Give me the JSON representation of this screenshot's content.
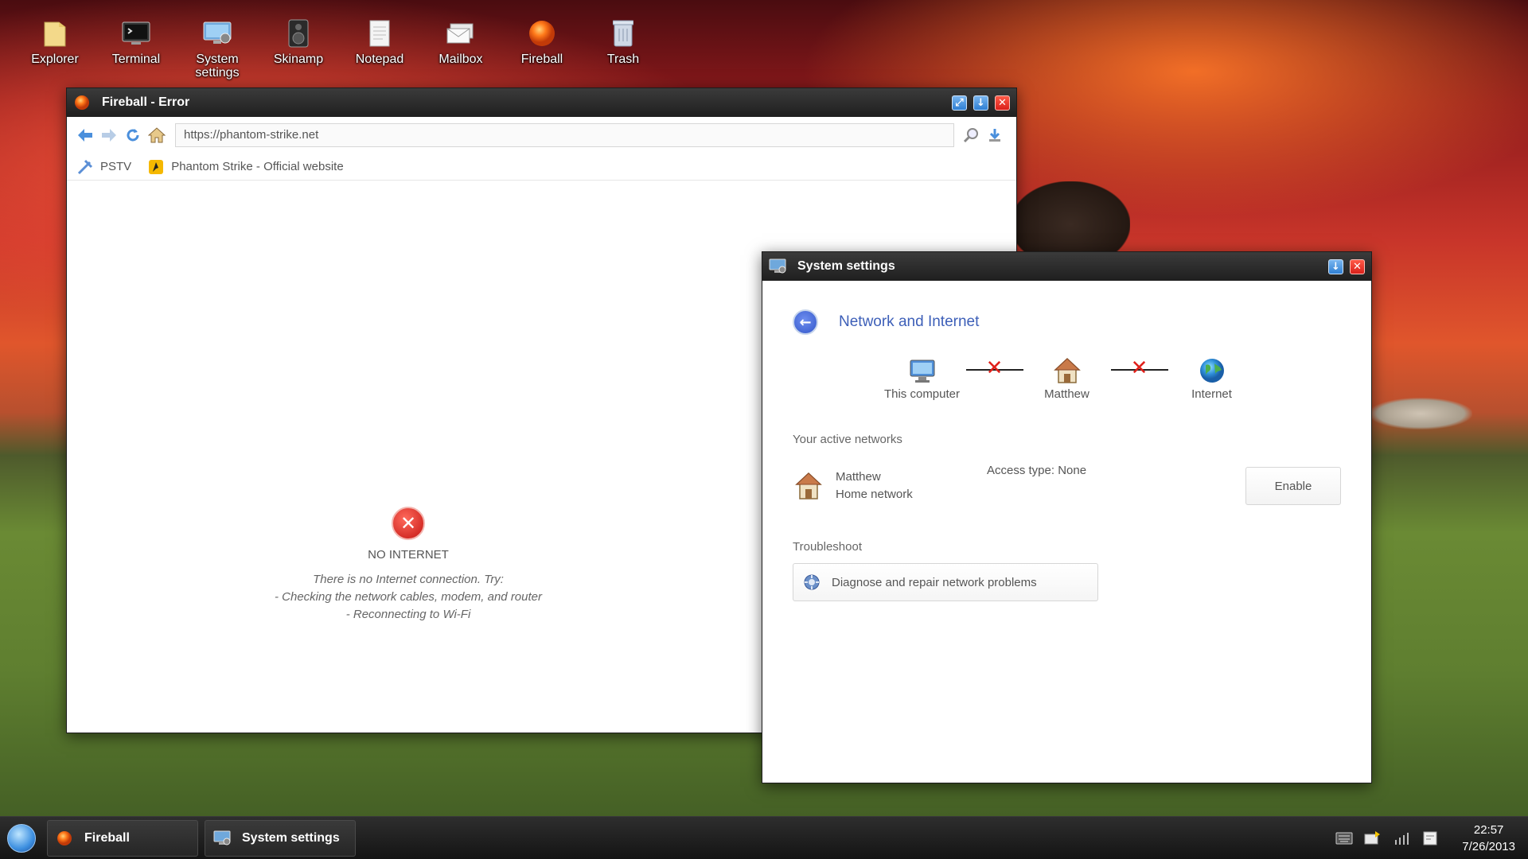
{
  "desktop": {
    "icons": [
      {
        "label": "Explorer",
        "icon": "folder-icon"
      },
      {
        "label": "Terminal",
        "icon": "terminal-icon"
      },
      {
        "label": "System settings",
        "icon": "system-settings-icon"
      },
      {
        "label": "Skinamp",
        "icon": "speaker-icon"
      },
      {
        "label": "Notepad",
        "icon": "notepad-icon"
      },
      {
        "label": "Mailbox",
        "icon": "mailbox-icon"
      },
      {
        "label": "Fireball",
        "icon": "fireball-icon"
      },
      {
        "label": "Trash",
        "icon": "trash-icon"
      }
    ]
  },
  "browser": {
    "title": "Fireball - Error",
    "url": "https://phantom-strike.net",
    "bookmarks": [
      {
        "label": "PSTV",
        "icon": "pstv-icon"
      },
      {
        "label": "Phantom Strike - Official website",
        "icon": "phantom-strike-icon"
      }
    ],
    "error": {
      "title": "NO INTERNET",
      "line1": "There is no Internet connection. Try:",
      "line2": "- Checking the network cables, modem, and router",
      "line3": "- Reconnecting to Wi-Fi"
    }
  },
  "settings": {
    "title": "System settings",
    "heading": "Network and Internet",
    "nodes": {
      "computer": "This computer",
      "home": "Matthew",
      "internet": "Internet"
    },
    "active_networks_label": "Your active networks",
    "network": {
      "name": "Matthew",
      "type": "Home network",
      "access": "Access type: None"
    },
    "enable_label": "Enable",
    "troubleshoot_label": "Troubleshoot",
    "diagnose_label": "Diagnose and repair network problems"
  },
  "taskbar": {
    "tasks": [
      {
        "label": "Fireball",
        "icon": "fireball-icon"
      },
      {
        "label": "System settings",
        "icon": "system-settings-icon"
      }
    ],
    "time": "22:57",
    "date": "7/26/2013"
  },
  "colors": {
    "accent": "#3d5fb8",
    "error": "#d9201a",
    "titlebar": "#2b2b2b"
  }
}
